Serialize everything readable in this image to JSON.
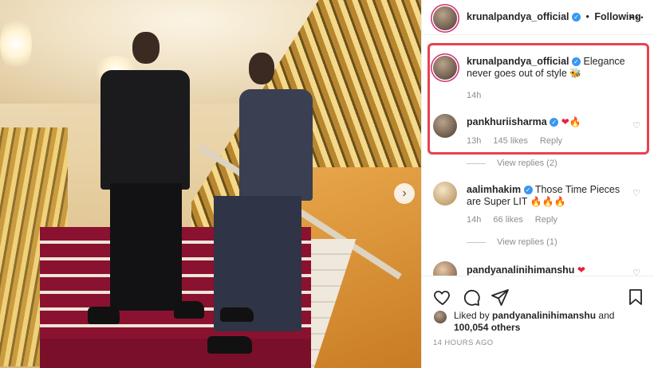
{
  "post": {
    "author": "krunalpandya_official",
    "header_separator": "•",
    "follow_status": "Following",
    "more_icon": "more-horizontal-icon"
  },
  "caption": {
    "author": "krunalpandya_official",
    "text": "Elegance never goes out of style",
    "emoji": "🐝",
    "time": "14h"
  },
  "comments": [
    {
      "author": "pankhuriisharma",
      "verified": true,
      "text": "",
      "emoji": [
        "❤",
        "🔥"
      ],
      "time": "13h",
      "likes": "145 likes",
      "reply": "Reply",
      "view_replies": "View replies (2)"
    },
    {
      "author": "aalimhakim",
      "verified": true,
      "text": "Those Time Pieces are Super LIT",
      "emoji": [
        "🔥",
        "🔥",
        "🔥"
      ],
      "time": "14h",
      "likes": "66 likes",
      "reply": "Reply",
      "view_replies": "View replies (1)"
    },
    {
      "author": "pandyanalinihimanshu",
      "verified": false,
      "text": "",
      "emoji": [
        "❤"
      ],
      "time": "",
      "likes": "",
      "reply": "",
      "view_replies": ""
    }
  ],
  "likes": {
    "prefix": "Liked by",
    "user": "pandyanalinihimanshu",
    "conjunction": "and",
    "others": "100,054 others"
  },
  "timestamp": "14 HOURS AGO",
  "colors": {
    "highlight_border": "#e8424f",
    "verified_blue": "#3897f0",
    "muted_text": "#8e8e8e"
  }
}
